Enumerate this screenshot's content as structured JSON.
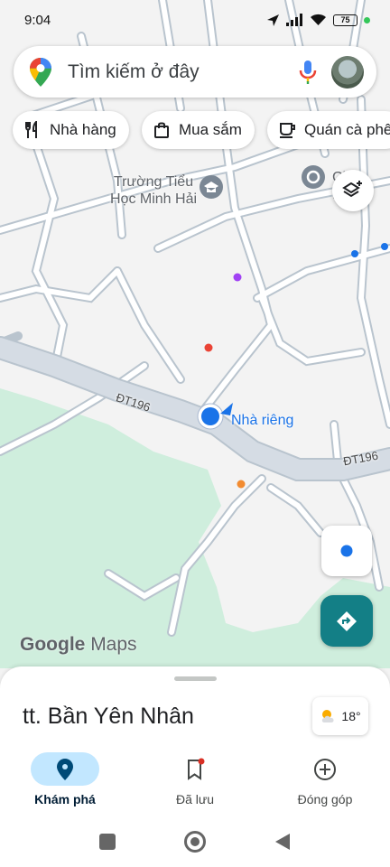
{
  "status": {
    "time": "9:04",
    "battery": "75"
  },
  "search": {
    "placeholder": "Tìm kiếm ở đây"
  },
  "chips": [
    {
      "label": "Nhà hàng",
      "icon": "restaurant-icon"
    },
    {
      "label": "Mua sắm",
      "icon": "shopping-bag-icon"
    },
    {
      "label": "Quán cà phê",
      "icon": "coffee-icon"
    }
  ],
  "map": {
    "poi_school_line1": "Trường Tiểu",
    "poi_school_line2": "Học Minh Hải",
    "poi_other": "Chùa Hư",
    "road_label_1": "ĐT196",
    "road_label_2": "ĐT196",
    "home_label": "Nhà riêng",
    "attribution_google": "Google",
    "attribution_maps": "Maps"
  },
  "sheet": {
    "place_name": "tt. Bần Yên Nhân",
    "temperature": "18°"
  },
  "nav": [
    {
      "label": "Khám phá",
      "icon": "explore-pin-icon",
      "active": true
    },
    {
      "label": "Đã lưu",
      "icon": "bookmark-icon",
      "active": false
    },
    {
      "label": "Đóng góp",
      "icon": "add-circle-icon",
      "active": false
    }
  ],
  "colors": {
    "accent": "#1a73e8",
    "active_nav_bg": "#c2e7ff",
    "directions_fab": "#137f86",
    "park_green": "#cfeedd",
    "road": "#d5dce4",
    "road_outline": "#b9c4ce"
  }
}
